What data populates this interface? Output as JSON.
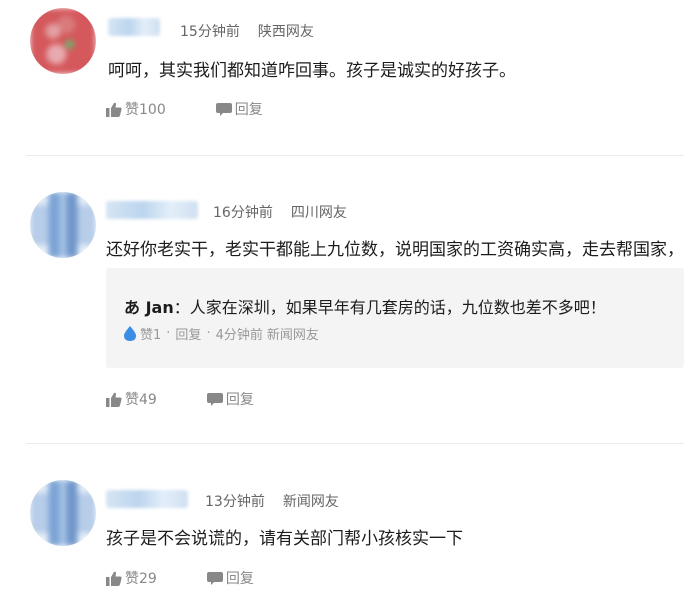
{
  "comments": [
    {
      "time": "15分钟前",
      "location": "陕西网友",
      "text": "呵呵，其实我们都知道咋回事。孩子是诚实的好孩子。",
      "like_label": "赞100",
      "reply_label": "回复"
    },
    {
      "time": "16分钟前",
      "location": "四川网友",
      "text": "还好你老实干，老实干都能上九位数，说明国家的工资确实高，走去帮国家，",
      "like_label": "赞49",
      "reply_label": "回复",
      "quote": {
        "author": "あ Jan",
        "separator": "：",
        "text": "人家在深圳，如果早年有几套房的话，九位数也差不多吧！",
        "like_label": "赞1",
        "dot": "·",
        "reply_label": "回复",
        "time": "4分钟前",
        "location": "新闻网友"
      }
    },
    {
      "time": "13分钟前",
      "location": "新闻网友",
      "text": "孩子是不会说谎的，请有关部门帮小孩核实一下",
      "like_label": "赞29",
      "reply_label": "回复"
    }
  ],
  "icons": {
    "like": "thumbs-up-icon",
    "reply": "speech-bubble-icon",
    "quote_like": "water-drop-icon"
  },
  "colors": {
    "quote_like_icon": "#3a8ee6",
    "meta_text": "#666666",
    "action_text": "#888888"
  }
}
